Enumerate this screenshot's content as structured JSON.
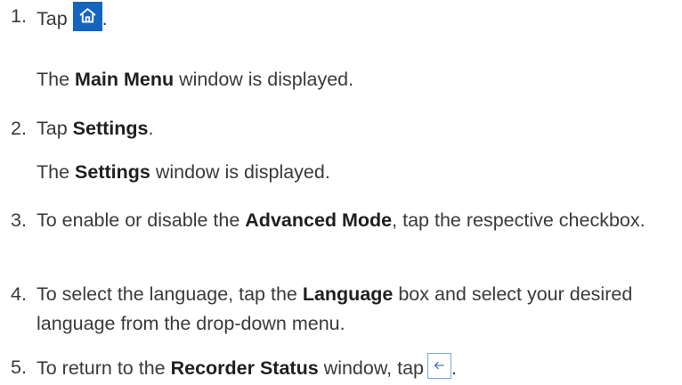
{
  "steps": [
    {
      "number": "1.",
      "pre": "Tap",
      "icon": "home-icon",
      "post": ".",
      "result": {
        "pre": "The ",
        "bold": "Main Menu",
        "post": " window is displayed."
      }
    },
    {
      "number": "2.",
      "pre": "Tap ",
      "bold": "Settings",
      "post": ".",
      "result": {
        "pre": "The ",
        "bold": "Settings",
        "post": " window is displayed."
      }
    },
    {
      "number": "3.",
      "pre": "To enable or disable the ",
      "bold": "Advanced Mode",
      "post": ", tap the respective checkbox."
    },
    {
      "number": "4.",
      "pre": "To select the language, tap the ",
      "bold": "Language",
      "post": " box and select your desired language from the drop-down menu."
    },
    {
      "number": "5.",
      "pre": "To return to the ",
      "bold": "Recorder Status",
      "post": " window, tap",
      "icon": "back-arrow-icon",
      "end": "."
    }
  ],
  "colors": {
    "home_button_bg": "#1565c0",
    "back_button_border": "#7aa6d6",
    "text": "#3a3a3a"
  }
}
